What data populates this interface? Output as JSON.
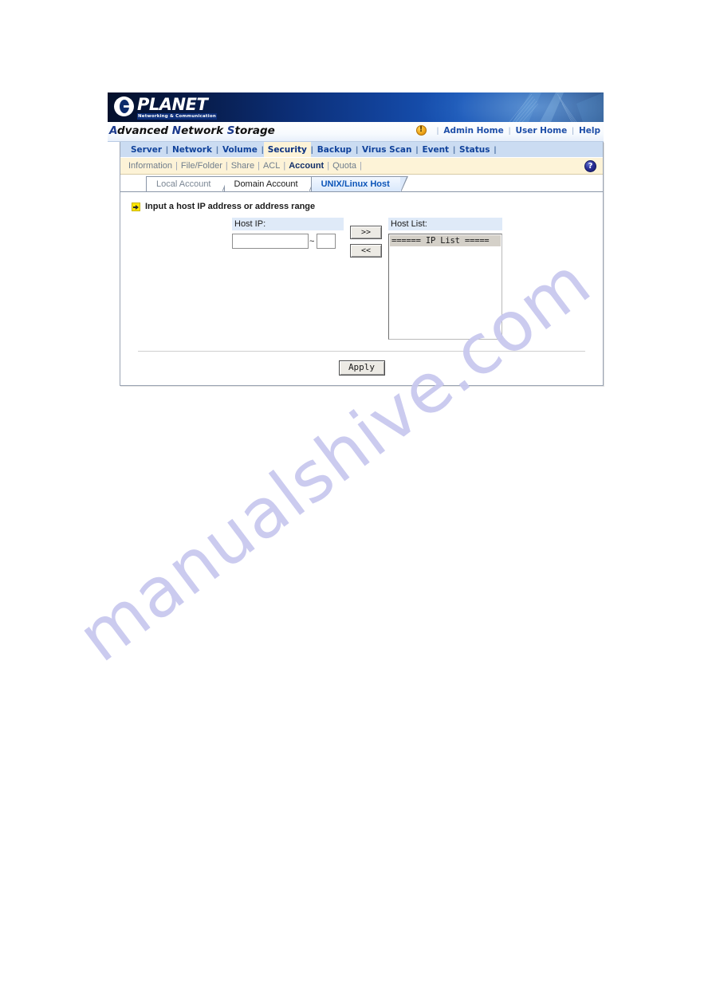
{
  "banner": {
    "logo_word": "PLANET",
    "logo_tagline": "Networking & Communication"
  },
  "titlebar": {
    "product_title": "Advanced Network Storage",
    "warning_icon": "warning-icon",
    "links": [
      {
        "label": "Admin Home"
      },
      {
        "label": "User Home"
      },
      {
        "label": "Help"
      }
    ],
    "separator": "|"
  },
  "mainnav": {
    "separator": "|",
    "items": [
      {
        "label": "Server",
        "active": false
      },
      {
        "label": "Network",
        "active": false
      },
      {
        "label": "Volume",
        "active": false
      },
      {
        "label": "Security",
        "active": true
      },
      {
        "label": "Backup",
        "active": false
      },
      {
        "label": "Virus Scan",
        "active": false
      },
      {
        "label": "Event",
        "active": false
      },
      {
        "label": "Status",
        "active": false
      }
    ]
  },
  "subnav": {
    "separator": "|",
    "help_icon": "help-icon",
    "items": [
      {
        "label": "Information",
        "active": false
      },
      {
        "label": "File/Folder",
        "active": false
      },
      {
        "label": "Share",
        "active": false
      },
      {
        "label": "ACL",
        "active": false
      },
      {
        "label": "Account",
        "active": true
      },
      {
        "label": "Quota",
        "active": false
      }
    ]
  },
  "tabs": [
    {
      "label": "Local Account",
      "active": false,
      "style": "muted"
    },
    {
      "label": "Domain Account",
      "active": false,
      "style": "dark"
    },
    {
      "label": "UNIX/Linux Host",
      "active": true,
      "style": "active"
    }
  ],
  "form": {
    "hint_icon": "arrow-right-icon",
    "hint": "Input a host IP address or address range",
    "host_ip_label": "Host IP:",
    "host_ip_value": "",
    "host_ip_placeholder": "",
    "host_ip_range_separator": "~",
    "host_ip_end_value": "",
    "host_ip_end_placeholder": "",
    "add_button": ">>",
    "remove_button": "<<",
    "host_list_label": "Host List:",
    "host_list_items": [
      "====== IP List ====="
    ]
  },
  "footer": {
    "apply_label": "Apply"
  },
  "watermark": {
    "text": "manualshive.com"
  },
  "colors": {
    "banner_blue": "#12439c",
    "nav_blue": "#cbdcf2",
    "subnav_cream": "#fdf3d7",
    "link_blue": "#1d4ea8",
    "active_tab_blue": "#0b54b8",
    "field_head_blue": "#dfeaf8",
    "list_select_gray": "#d4d0c8",
    "warning_orange": "#f0a81b",
    "arrow_yellow": "#ffe600",
    "watermark_purple": "#c9c9ef"
  }
}
